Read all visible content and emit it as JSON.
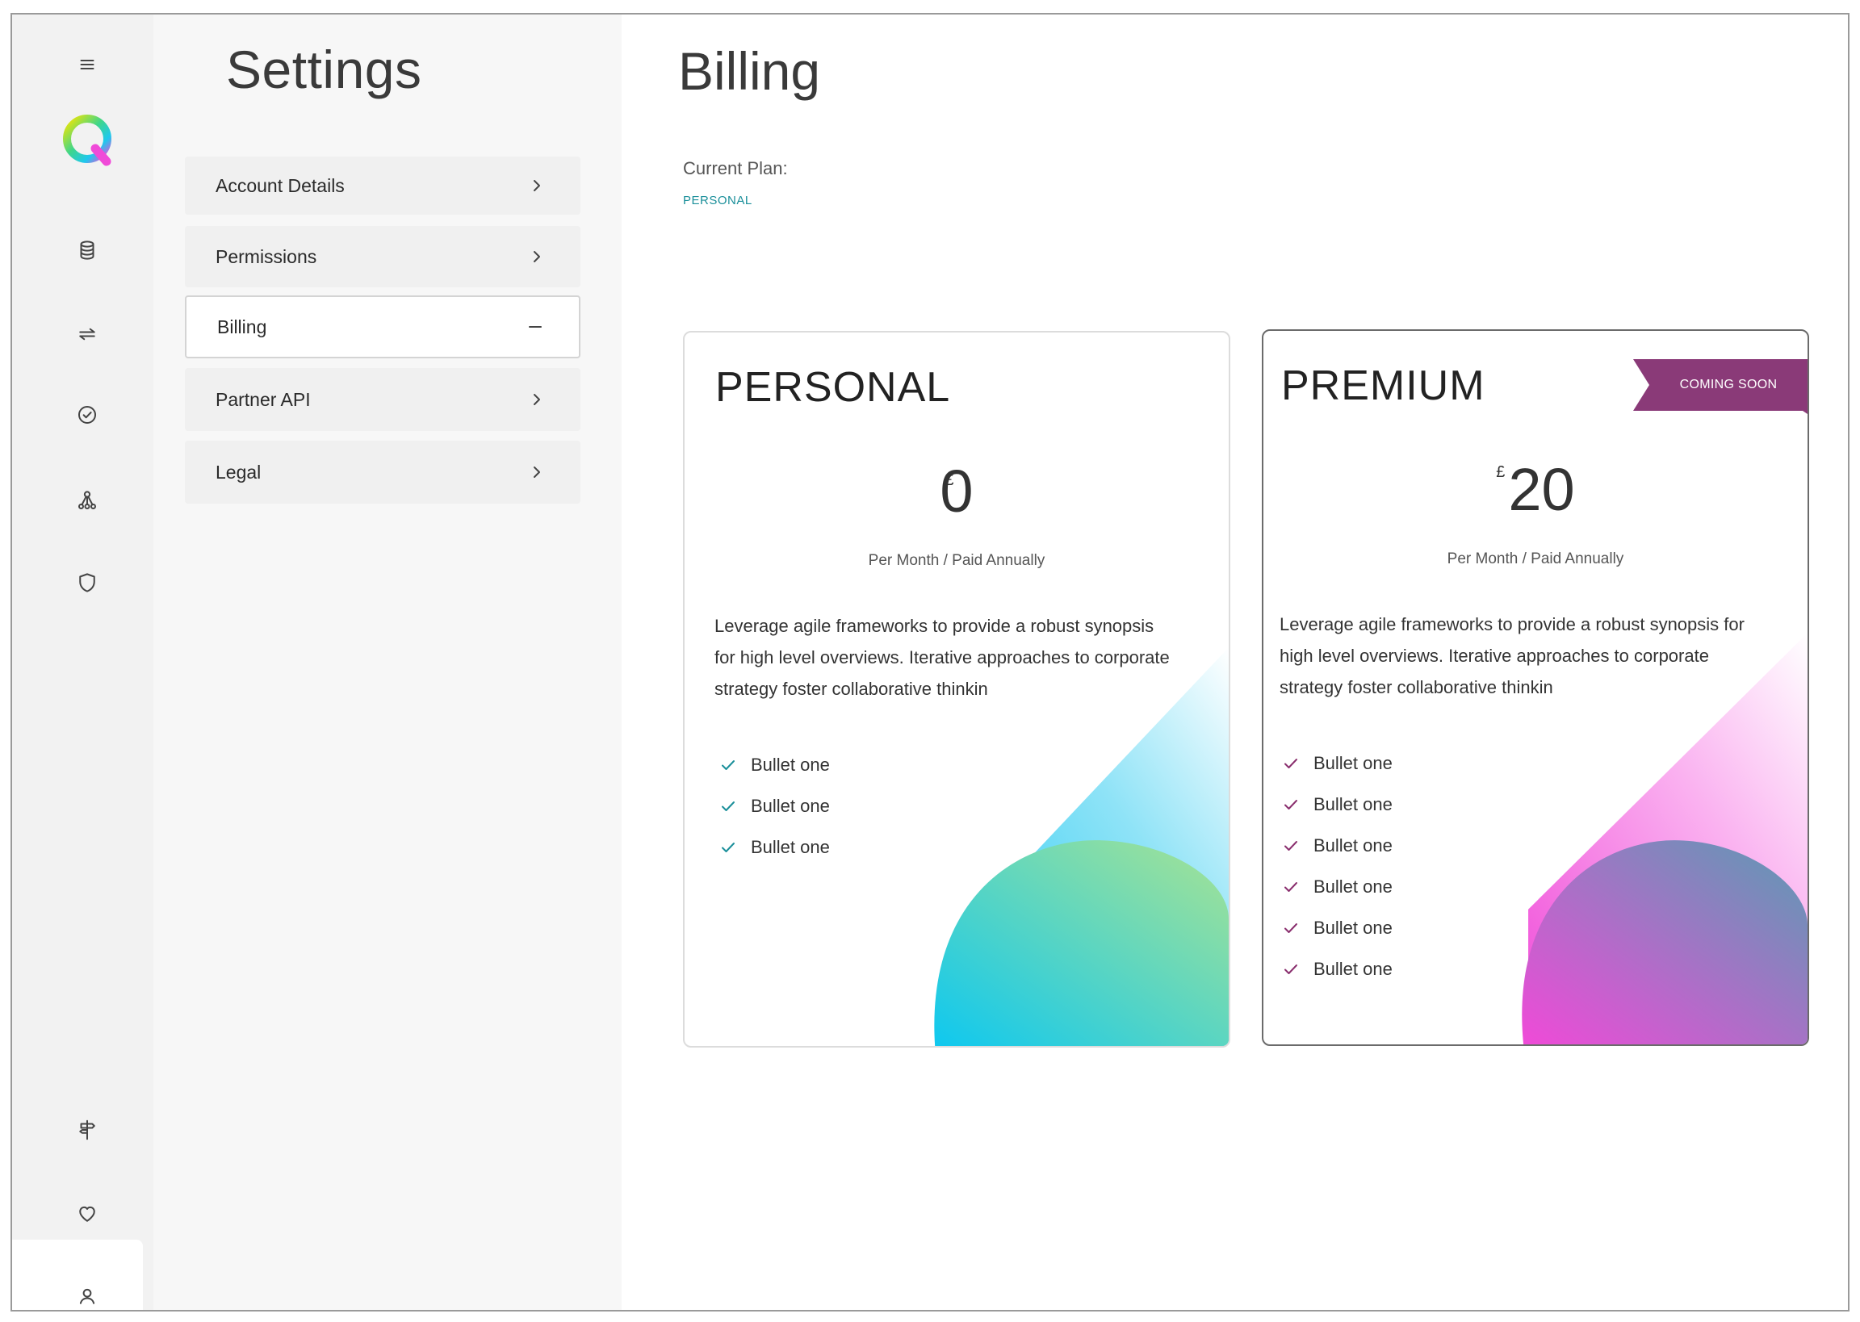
{
  "sidebar": {
    "icons": [
      "menu-icon",
      "logo-q",
      "database-icon",
      "swap-arrows-icon",
      "check-circle-icon",
      "network-icon",
      "shield-icon",
      "signpost-icon",
      "heart-icon",
      "user-icon"
    ]
  },
  "settings": {
    "title": "Settings",
    "items": [
      {
        "label": "Account Details",
        "icon": "chevron-right-icon"
      },
      {
        "label": "Permissions",
        "icon": "chevron-right-icon"
      },
      {
        "label": "Billing",
        "icon": "minus-icon",
        "active": true
      },
      {
        "label": "Partner API",
        "icon": "chevron-right-icon"
      },
      {
        "label": "Legal",
        "icon": "chevron-right-icon"
      }
    ]
  },
  "billing": {
    "title": "Billing",
    "current_plan_label": "Current Plan:",
    "current_plan_value": "PERSONAL",
    "plans": [
      {
        "name": "PERSONAL",
        "currency": "£",
        "price": "0",
        "period": "Per Month / Paid Annually",
        "description": "Leverage agile frameworks to provide a robust synopsis for high level overviews. Iterative approaches to corporate strategy foster collaborative thinkin",
        "bullets": [
          "Bullet one",
          "Bullet one",
          "Bullet one"
        ],
        "accent": "#1a8f9a"
      },
      {
        "name": "PREMIUM",
        "badge": "COMING SOON",
        "currency": "£",
        "price": "20",
        "period": "Per Month / Paid Annually",
        "description": "Leverage agile frameworks to provide a robust synopsis for high level overviews. Iterative approaches to corporate strategy foster collaborative thinkin",
        "bullets": [
          "Bullet one",
          "Bullet one",
          "Bullet one",
          "Bullet one",
          "Bullet one",
          "Bullet one"
        ],
        "accent": "#8a2f6e"
      }
    ]
  },
  "colors": {
    "teal": "#1a8f9a",
    "plum": "#8a3a78"
  }
}
